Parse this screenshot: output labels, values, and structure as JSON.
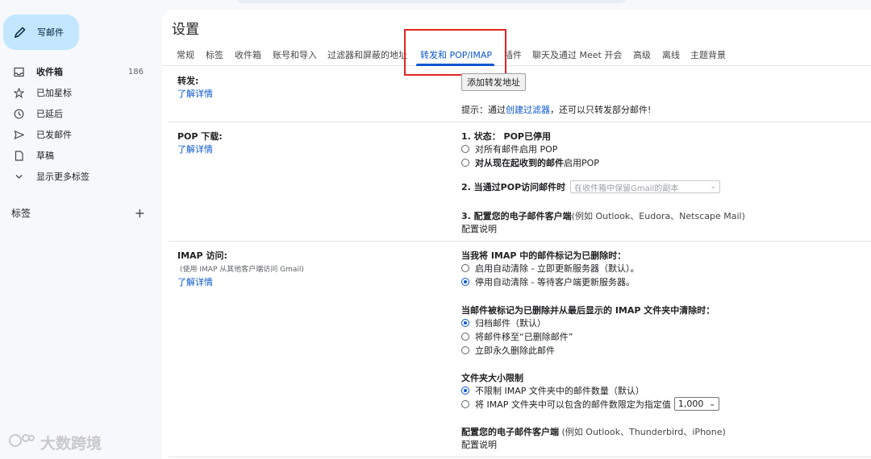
{
  "sidebar": {
    "compose_label": "写邮件",
    "items": [
      {
        "label": "收件箱",
        "count": "186"
      },
      {
        "label": "已加星标"
      },
      {
        "label": "已延后"
      },
      {
        "label": "已发邮件"
      },
      {
        "label": "草稿"
      },
      {
        "label": "显示更多标签"
      }
    ],
    "labels_heading": "标签",
    "labels_add": "+"
  },
  "watermark": "大数跨境",
  "settings": {
    "title": "设置",
    "tabs": [
      "常规",
      "标签",
      "收件箱",
      "账号和导入",
      "过滤器和屏蔽的地址",
      "转发和 POP/IMAP",
      "插件",
      "聊天及通过 Meet 开会",
      "高级",
      "离线",
      "主题背景"
    ],
    "active_tab": "转发和 POP/IMAP"
  },
  "forwarding": {
    "title": "转发:",
    "learn_more": "了解详情",
    "add_button": "添加转发地址",
    "tip_prefix": "提示：通过",
    "tip_link": "创建过滤器",
    "tip_suffix": "，还可以只转发部分邮件!"
  },
  "pop": {
    "title": "POP 下载:",
    "learn_more": "了解详情",
    "status_label": "1. 状态：",
    "status_value": "POP已停用",
    "option_all": "对所有邮件启用 POP",
    "option_now_prefix": "对从现在起收到的邮件",
    "option_now_suffix": "启用POP",
    "when_accessed": "2. 当通过POP访问邮件时",
    "when_select": "在收件箱中保留Gmail的副本",
    "configure_label": "3. 配置您的电子邮件客户端",
    "configure_hint": "(例如 Outlook、Eudora、Netscape Mail)",
    "configure_link": "配置说明"
  },
  "imap": {
    "title": "IMAP 访问:",
    "subtitle": "(使用 IMAP 从其他客户端访问 Gmail)",
    "learn_more": "了解详情",
    "deleted_heading": "当我将 IMAP 中的邮件标记为已删除时：",
    "auto_on": "启用自动清除 - 立即更新服务器（默认）。",
    "auto_off": "停用自动清除 - 等待客户端更新服务器。",
    "expunge_heading": "当邮件被标记为已删除并从最后显示的 IMAP 文件夹中清除时：",
    "archive": "归档邮件（默认）",
    "move_trash": "将邮件移至“已删除邮件”",
    "delete_forever": "立即永久删除此邮件",
    "folder_heading": "文件夹大小限制",
    "no_limit": "不限制 IMAP 文件夹中的邮件数量（默认）",
    "limit": "将 IMAP 文件夹中可以包含的邮件数限定为指定值",
    "limit_value": "1,000",
    "client_label": "配置您的电子邮件客户端",
    "client_hint": "(例如 Outlook、Thunderbird、iPhone)",
    "client_link": "配置说明"
  }
}
